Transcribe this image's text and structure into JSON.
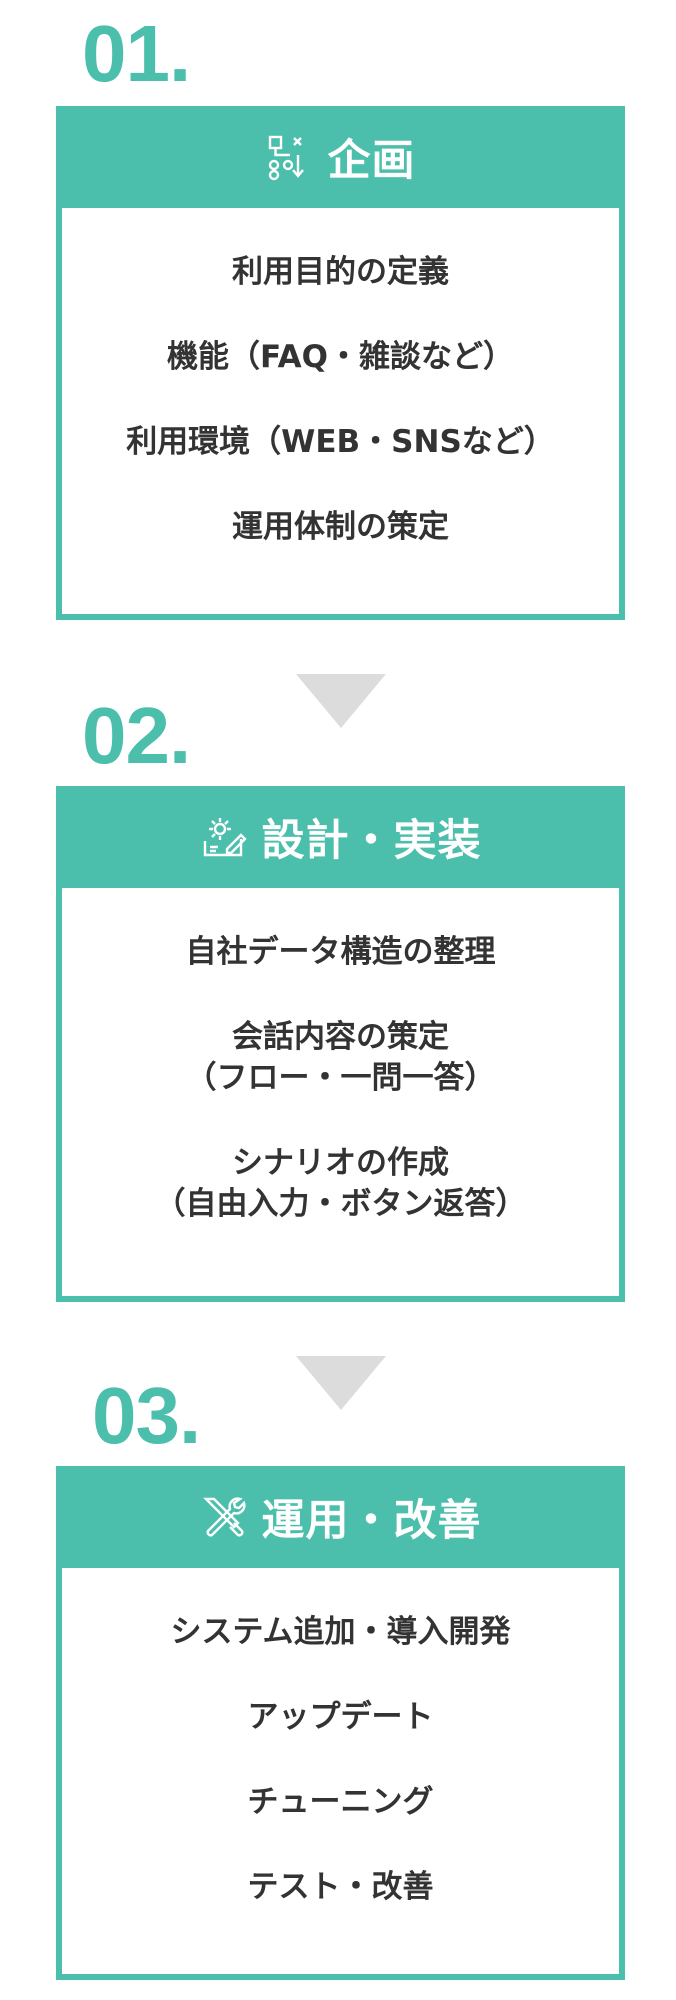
{
  "steps": [
    {
      "number": "01.",
      "title": "企画",
      "icon": "flowchart-icon",
      "items": [
        [
          "利用目的の定義"
        ],
        [
          "機能（FAQ・雑談など）"
        ],
        [
          "利用環境（WEB・SNSなど）"
        ],
        [
          "運用体制の策定"
        ]
      ]
    },
    {
      "number": "02.",
      "title": "設計・実装",
      "icon": "gear-edit-icon",
      "items": [
        [
          "自社データ構造の整理"
        ],
        [
          "会話内容の策定",
          "（フロー・一問一答）"
        ],
        [
          "シナリオの作成",
          "（自由入力・ボタン返答）"
        ]
      ]
    },
    {
      "number": "03.",
      "title": "運用・改善",
      "icon": "tools-icon",
      "items": [
        [
          "システム追加・導入開発"
        ],
        [
          "アップデート"
        ],
        [
          "チューニング"
        ],
        [
          "テスト・改善"
        ]
      ]
    }
  ],
  "colors": {
    "accent": "#4bbfac",
    "arrow": "#dcdcdc",
    "text": "#333333"
  }
}
